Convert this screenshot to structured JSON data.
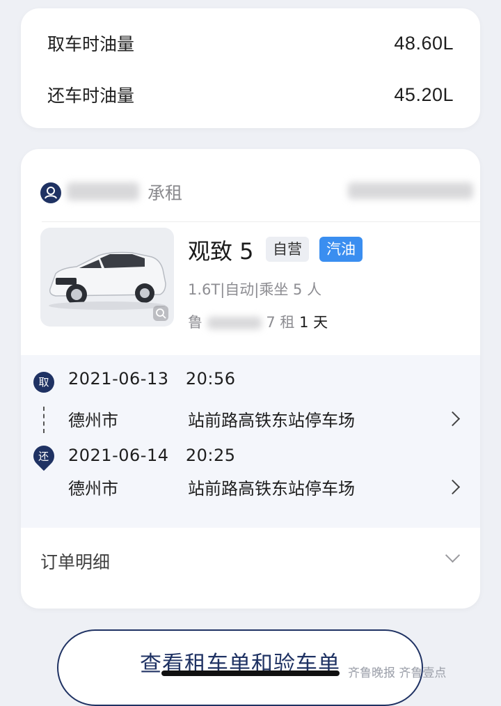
{
  "fuel": {
    "pickup_label": "取车时油量",
    "pickup_value": "48.60L",
    "return_label": "还车时油量",
    "return_value": "45.20L"
  },
  "renter": {
    "label": "承租"
  },
  "car": {
    "name": "观致 5",
    "tag_self": "自营",
    "tag_fuel": "汽油",
    "specs": "1.6T|自动|乘坐 5 人",
    "rent_prefix": "鲁",
    "rent_suffix": "7 租",
    "rent_days": "1",
    "rent_unit": "天"
  },
  "pickup": {
    "badge": "取",
    "date": "2021-06-13",
    "time": "20:56",
    "city": "德州市",
    "place": "站前路高铁东站停车场"
  },
  "return": {
    "badge": "还",
    "date": "2021-06-14",
    "time": "20:25",
    "city": "德州市",
    "place": "站前路高铁东站停车场"
  },
  "details": {
    "label": "订单明细"
  },
  "bottom_button": {
    "label": "查看租车单和验车单"
  },
  "watermark": {
    "text": "齐鲁晚报 齐鲁壹点"
  },
  "colors": {
    "navy": "#1f3263",
    "fuel_tag": "#3a8ef0",
    "background": "#eef0f5"
  }
}
